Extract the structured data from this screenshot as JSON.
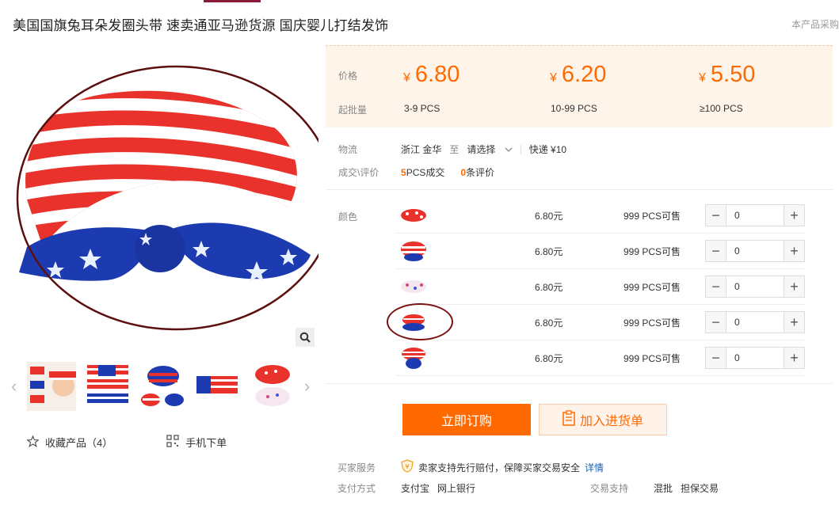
{
  "header": {
    "title": "美国国旗兔耳朵发圈头带 速卖通亚马逊货源 国庆婴儿打结发饰",
    "top_right": "本产品采购"
  },
  "gallery": {
    "zoom_icon": "magnifier-icon",
    "prev_icon": "chevron-left-icon",
    "next_icon": "chevron-right-icon"
  },
  "actions": {
    "favorite_label": "收藏产品（4）",
    "mobile_order_label": "手机下单"
  },
  "pricing": {
    "price_label": "价格",
    "moq_label": "起批量",
    "currency": "¥",
    "tiers": [
      {
        "price": "6.80",
        "qty": "3-9  PCS"
      },
      {
        "price": "6.20",
        "qty": "10-99  PCS"
      },
      {
        "price": "5.50",
        "qty": "≥100  PCS"
      }
    ]
  },
  "logistics": {
    "label": "物流",
    "origin": "浙江 金华",
    "to": "至",
    "select": "请选择",
    "express": "快递 ¥10"
  },
  "deals": {
    "label": "成交\\评价",
    "sold_count": "5",
    "sold_suffix": "PCS成交",
    "review_count": "0",
    "review_suffix": "条评价"
  },
  "skus": {
    "label": "颜色",
    "items": [
      {
        "price": "6.80元",
        "stock": "999 PCS可售",
        "qty": "0"
      },
      {
        "price": "6.80元",
        "stock": "999 PCS可售",
        "qty": "0"
      },
      {
        "price": "6.80元",
        "stock": "999 PCS可售",
        "qty": "0"
      },
      {
        "price": "6.80元",
        "stock": "999 PCS可售",
        "qty": "0"
      },
      {
        "price": "6.80元",
        "stock": "999 PCS可售",
        "qty": "0"
      }
    ]
  },
  "buttons": {
    "buy_now": "立即订购",
    "add_to_list": "加入进货单"
  },
  "service": {
    "label": "买家服务",
    "text": "卖家支持先行赔付，保障买家交易安全",
    "detail_link": "详情"
  },
  "payment": {
    "label": "支付方式",
    "methods": "支付宝   网上银行",
    "trade_label": "交易支持",
    "trade_methods": "混批   担保交易"
  },
  "colors": {
    "accent": "#ff6a00",
    "flag_red": "#e8322b",
    "flag_blue": "#1d3bb0"
  }
}
